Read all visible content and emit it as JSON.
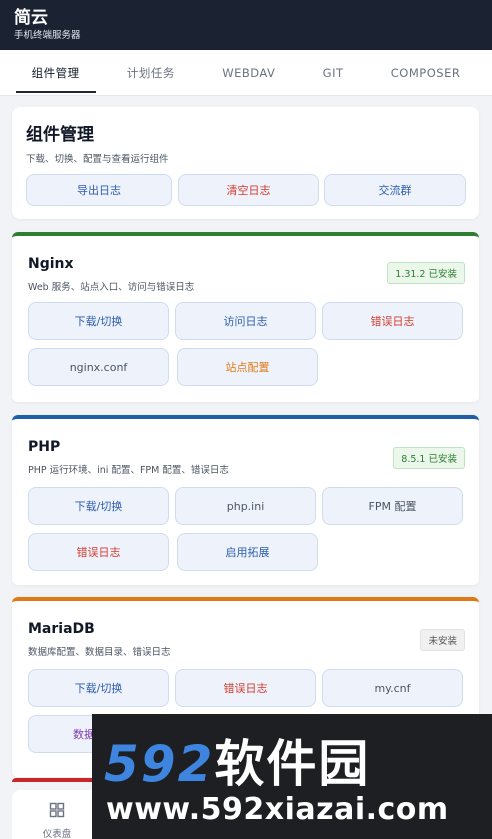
{
  "app": {
    "title": "简云",
    "subtitle": "手机终端服务器"
  },
  "tabs": [
    {
      "label": "组件管理",
      "active": true
    },
    {
      "label": "计划任务",
      "active": false
    },
    {
      "label": "WEBDAV",
      "active": false
    },
    {
      "label": "GIT",
      "active": false
    },
    {
      "label": "COMPOSER",
      "active": false
    }
  ],
  "manager": {
    "title": "组件管理",
    "desc": "下载、切换、配置与查看运行组件",
    "buttons": [
      "导出日志",
      "清空日志",
      "交流群"
    ]
  },
  "components": [
    {
      "name": "Nginx",
      "desc": "Web 服务、站点入口、访问与错误日志",
      "status": "1.31.2 已安装",
      "accent": "#2e7d32",
      "buttons": [
        "下载/切换",
        "访问日志",
        "错误日志",
        "nginx.conf",
        "站点配置"
      ]
    },
    {
      "name": "PHP",
      "desc": "PHP 运行环境、ini 配置、FPM 配置、错误日志",
      "status": "8.5.1 已安装",
      "accent": "#1e5fa8",
      "buttons": [
        "下载/切换",
        "php.ini",
        "FPM 配置",
        "错误日志",
        "启用拓展"
      ]
    },
    {
      "name": "MariaDB",
      "desc": "数据库配置、数据目录、错误日志",
      "status": "未安装",
      "accent": "#e07a16",
      "buttons": [
        "下载/切换",
        "错误日志",
        "my.cnf",
        "数据"
      ]
    }
  ],
  "bottom_nav": {
    "label": "仪表盘",
    "icon": "dashboard-icon"
  },
  "watermark": {
    "brand_num": "592",
    "brand_cn": "软件园",
    "url": "www.592xiazai.com"
  },
  "colors": {
    "header": "#1b2333",
    "button_bg": "#eef3fb",
    "red_text": "#d23b2f",
    "blue_text": "#2f5db1",
    "orange_text": "#e07a16"
  }
}
